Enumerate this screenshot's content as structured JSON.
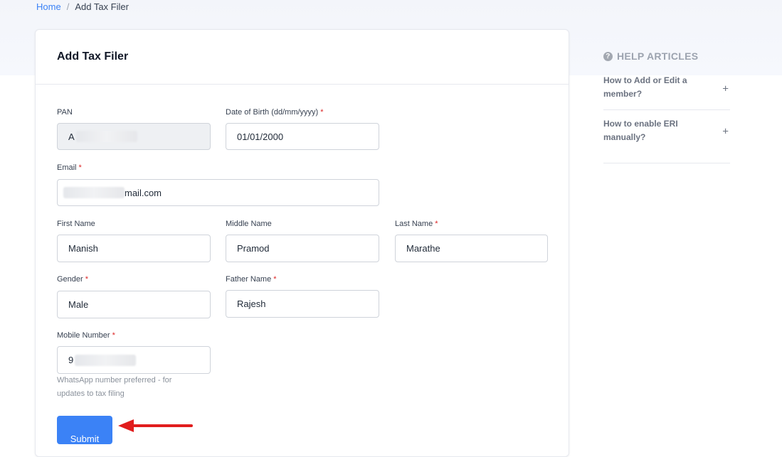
{
  "breadcrumb": {
    "home": "Home",
    "separator": "/",
    "current": "Add Tax Filer"
  },
  "form": {
    "title": "Add Tax Filer",
    "pan": {
      "label": "PAN",
      "value_visible": "A"
    },
    "dob": {
      "label": "Date of Birth (dd/mm/yyyy)",
      "required": "*",
      "value": "01/01/2000"
    },
    "email": {
      "label": "Email",
      "required": "*",
      "value_visible": "mail.com"
    },
    "first_name": {
      "label": "First Name",
      "value": "Manish"
    },
    "middle_name": {
      "label": "Middle Name",
      "value": "Pramod"
    },
    "last_name": {
      "label": "Last Name",
      "required": "*",
      "value": "Marathe"
    },
    "gender": {
      "label": "Gender",
      "required": "*",
      "value": "Male"
    },
    "father_name": {
      "label": "Father Name",
      "required": "*",
      "value": "Rajesh"
    },
    "mobile": {
      "label": "Mobile Number",
      "required": "*",
      "value_visible": "9",
      "hint": "WhatsApp number preferred - for updates to tax filing"
    },
    "submit_label": "Submit"
  },
  "help": {
    "title": "HELP ARTICLES",
    "icon": "question-circle-icon",
    "items": [
      {
        "label": "How to Add or Edit a member?",
        "icon": "plus-icon",
        "glyph": "+"
      },
      {
        "label": "How to enable ERI manually?",
        "icon": "plus-icon",
        "glyph": "+"
      }
    ]
  },
  "colors": {
    "accent": "#3b82f6",
    "required": "#dc2626",
    "annotation_arrow": "#e11d1d"
  }
}
